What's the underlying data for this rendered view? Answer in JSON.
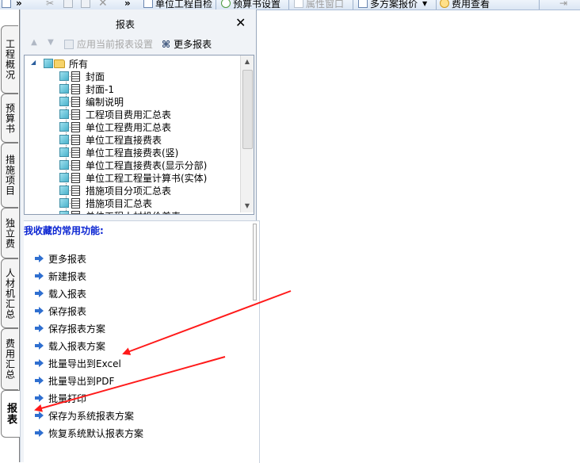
{
  "toolbar": {
    "items": [
      {
        "label": "单位工程自检"
      },
      {
        "label": "预算书设置"
      },
      {
        "label": "属性窗口"
      },
      {
        "label": "多方案报价"
      },
      {
        "label": "费用查看"
      }
    ],
    "overflow_glyph": "»"
  },
  "left_tabs": [
    {
      "label": "工程概况"
    },
    {
      "label": "预算书"
    },
    {
      "label": "措施项目"
    },
    {
      "label": "独立费"
    },
    {
      "label": "人材机汇总"
    },
    {
      "label": "费用汇总"
    },
    {
      "label": "报表",
      "active": true
    }
  ],
  "panel": {
    "title": "报表",
    "close_glyph": "✕",
    "apply_label": "应用当前报表设置",
    "more_label": "更多报表"
  },
  "tree": {
    "root_label": "所有",
    "items": [
      "封面",
      "封面-1",
      "编制说明",
      "工程项目费用汇总表",
      "单位工程费用汇总表",
      "单位工程直接费表",
      "单位工程直接费表(竖)",
      "单位工程直接费表(显示分部)",
      "单位工程工程量计算书(实体)",
      "措施项目分项汇总表",
      "措施项目汇总表",
      "单位工程人材机价差表"
    ]
  },
  "favorites": {
    "title": "我收藏的常用功能:",
    "items": [
      "更多报表",
      "新建报表",
      "载入报表",
      "保存报表",
      "保存报表方案",
      "载入报表方案",
      "批量导出到Excel",
      "批量导出到PDF",
      "批量打印",
      "保存为系统报表方案",
      "恢复系统默认报表方案"
    ]
  },
  "colors": {
    "favorites_title": "#0a24d2",
    "annotation_arrow": "#ff1a1a"
  }
}
